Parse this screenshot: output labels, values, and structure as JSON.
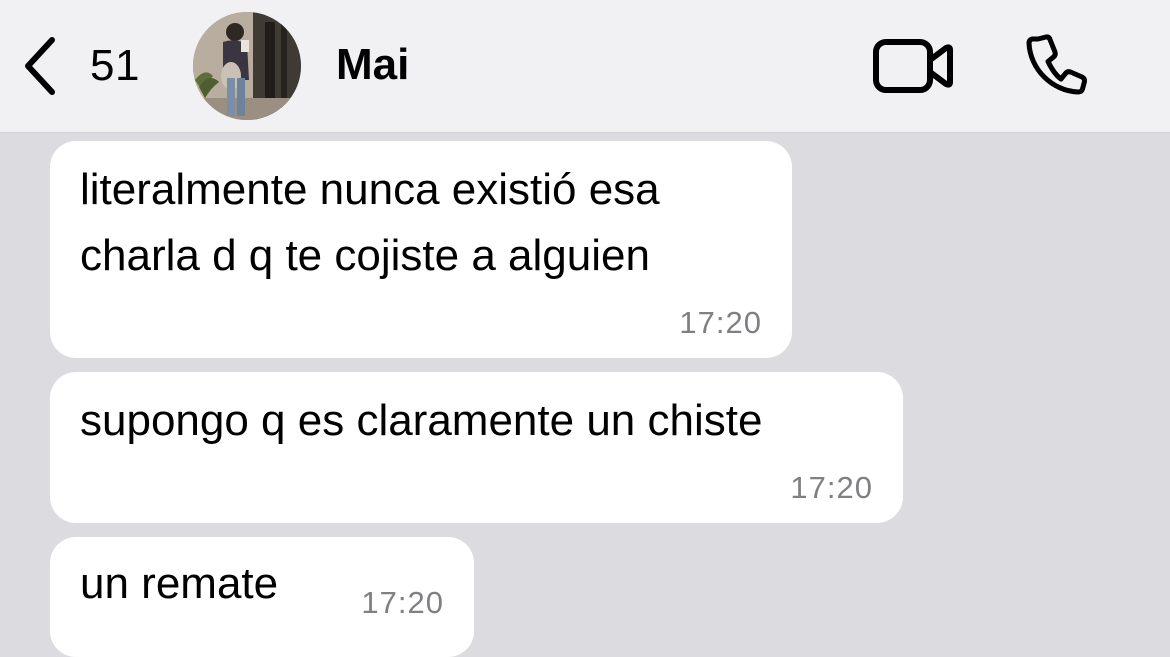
{
  "header": {
    "back_count": "51",
    "contact_name": "Mai",
    "back_icon": "chevron-left-icon",
    "video_icon": "video-camera-icon",
    "phone_icon": "phone-icon"
  },
  "messages": [
    {
      "lines": [
        "literalmente nunca existió esa",
        "charla d q te cojiste a alguien"
      ],
      "time": "17:20"
    },
    {
      "lines": [
        "supongo q es claramente un chiste"
      ],
      "time": "17:20"
    },
    {
      "lines": [
        "un remate"
      ],
      "time": "17:20"
    }
  ],
  "colors": {
    "header_bg": "#f1f1f3",
    "chat_bg": "#dcdce0",
    "bubble_bg": "#ffffff",
    "time_text": "#808084"
  }
}
